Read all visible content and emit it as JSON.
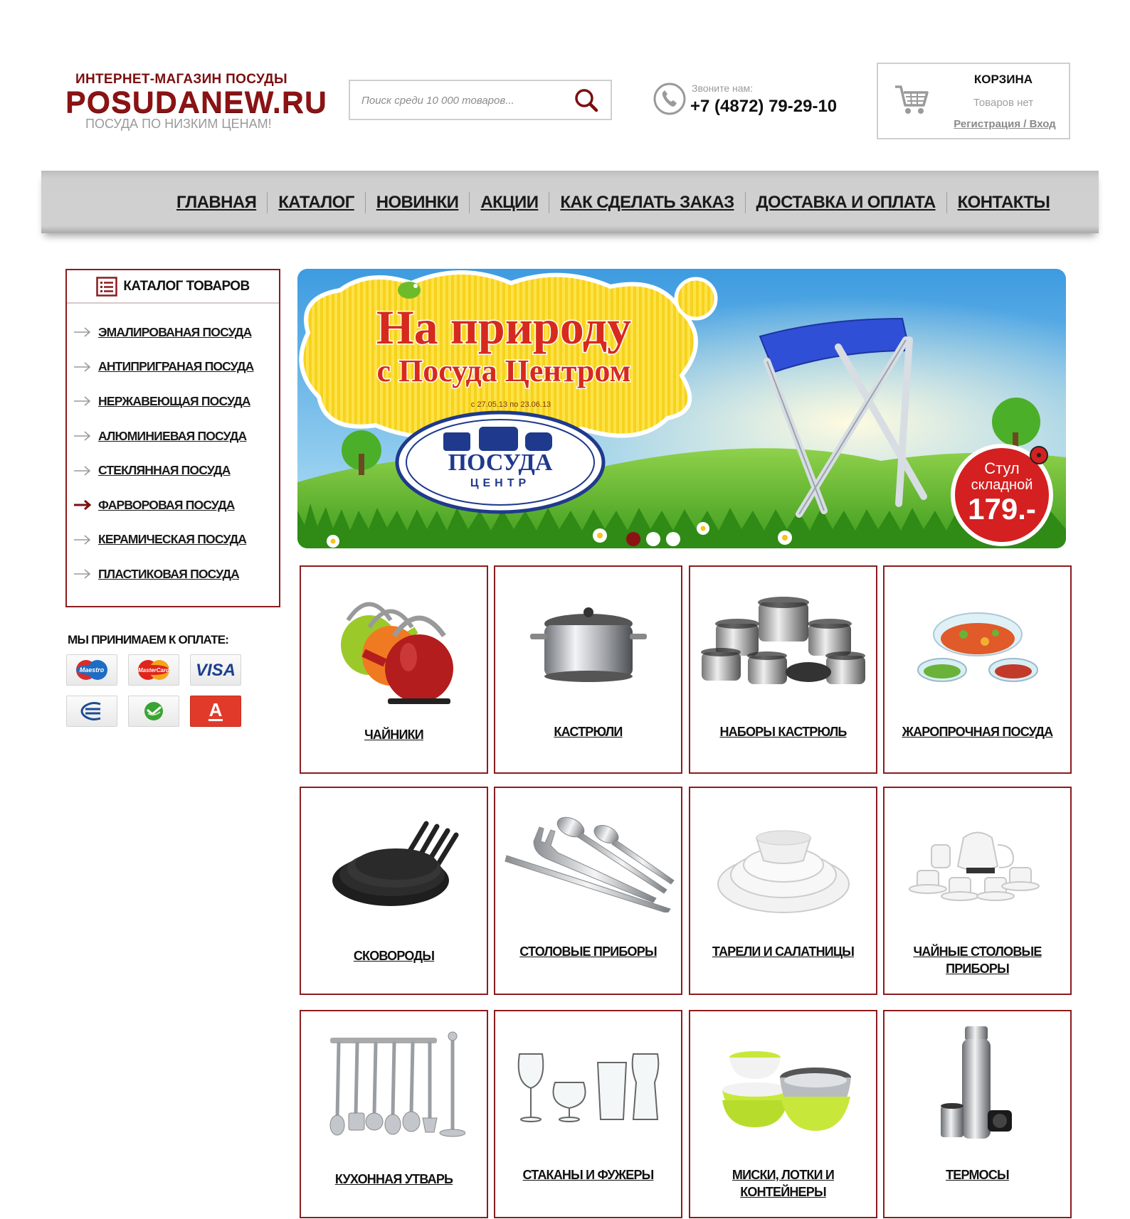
{
  "header": {
    "logo_top": "ИНТЕРНЕТ-МАГАЗИН ПОСУДЫ",
    "logo_main": "POSUDANEW.RU",
    "logo_sub": "ПОСУДА ПО НИЗКИМ ЦЕНАМ!",
    "search_placeholder": "Поиск среди 10 000 товаров...",
    "phone_label": "Звоните нам:",
    "phone_number": "+7 (4872) 79-29-10",
    "cart_title": "КОРЗИНА",
    "cart_empty": "Товаров нет",
    "cart_auth": "Регистрация / Вход"
  },
  "nav": [
    "ГЛАВНАЯ",
    "КАТАЛОГ",
    "НОВИНКИ",
    "АКЦИИ",
    "КАК СДЕЛАТЬ ЗАКАЗ",
    "ДОСТАВКА И ОПЛАТА",
    "КОНТАКТЫ"
  ],
  "sidebar": {
    "catalog_title": "КАТАЛОГ ТОВАРОВ",
    "items": [
      {
        "label": "ЭМАЛИРОВАНАЯ ПОСУДА",
        "active": false
      },
      {
        "label": "АНТИПРИГРАНАЯ ПОСУДА",
        "active": false
      },
      {
        "label": "НЕРЖАВЕЮЩАЯ ПОСУДА",
        "active": false
      },
      {
        "label": "АЛЮМИНИЕВАЯ ПОСУДА",
        "active": false
      },
      {
        "label": "СТЕКЛЯННАЯ ПОСУДА",
        "active": false
      },
      {
        "label": "ФАРВОРОВАЯ ПОСУДА",
        "active": true
      },
      {
        "label": "КЕРАМИЧЕСКАЯ ПОСУДА",
        "active": false
      },
      {
        "label": "ПЛАСТИКОВАЯ ПОСУДА",
        "active": false
      }
    ],
    "payment_title": "МЫ ПРИНИМАЕМ К ОПЛАТЕ:",
    "payment_methods": [
      "Maestro",
      "MasterCard",
      "VISA",
      "sberbank-icon",
      "sberbank-green-icon",
      "alfabank-icon"
    ],
    "visa_label": "VISA",
    "alfa_label": "А"
  },
  "banner": {
    "title_line1": "На природу",
    "title_line2": "с Посуда Центром",
    "dates": "с 27.05.13 по 23.06.13",
    "logo_line1": "ПОСУДА",
    "logo_line2": "ЦЕНТР",
    "promo_line1": "Стул",
    "promo_line2": "складной",
    "promo_price": "179.-",
    "slides": 3,
    "active_slide": 1
  },
  "categories": [
    {
      "label": "ЧАЙНИКИ",
      "icon": "kettle-icon"
    },
    {
      "label": "КАСТРЮЛИ",
      "icon": "pot-icon"
    },
    {
      "label": "НАБОРЫ КАСТРЮЛЬ",
      "icon": "pot-set-icon"
    },
    {
      "label": "ЖАРОПРОЧНАЯ ПОСУДА",
      "icon": "glass-dish-icon"
    },
    {
      "label": "СКОВОРОДЫ",
      "icon": "frying-pan-icon"
    },
    {
      "label": "СТОЛОВЫЕ ПРИБОРЫ",
      "icon": "cutlery-icon"
    },
    {
      "label": "ТАРЕЛИ И САЛАТНИЦЫ",
      "icon": "plates-icon"
    },
    {
      "label": "ЧАЙНЫЕ СТОЛОВЫЕ ПРИБОРЫ",
      "icon": "tea-set-icon"
    },
    {
      "label": "КУХОННАЯ УТВАРЬ",
      "icon": "kitchen-utensils-icon"
    },
    {
      "label": "СТАКАНЫ И ФУЖЕРЫ",
      "icon": "glasses-icon"
    },
    {
      "label": "МИСКИ, ЛОТКИ И КОНТЕЙНЕРЫ",
      "icon": "bowls-icon"
    },
    {
      "label": "ТЕРМОСЫ",
      "icon": "thermos-icon"
    }
  ],
  "colors": {
    "brand": "#8b1314",
    "border": "#8b1c1e",
    "nav_bg": "#cfcfcf"
  }
}
